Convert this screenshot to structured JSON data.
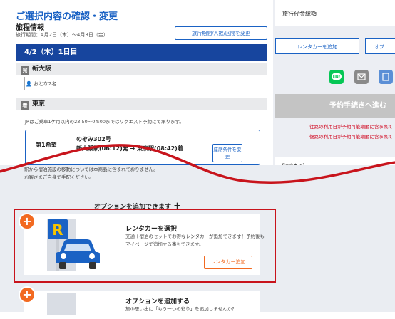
{
  "header": {
    "title": "ご選択内容の確認・変更",
    "subtitle": "旅程情報",
    "period": "旅行期間：4月2日（木）～4月3日（金）",
    "change_button": "旅行期間/人数/区間を変更"
  },
  "itinerary": {
    "day_header": "4/2（木）1日目",
    "departure_tag": "発",
    "departure": "新大阪",
    "adults": "おとな2名",
    "arrival_tag": "着",
    "arrival": "東京",
    "jr_note": "JRはご乗車1ケ月以内の23:50～04:00まではリクエスト予約にて承ります。",
    "wish_label": "第1希望",
    "train_name": "のぞみ302号",
    "route": "新大阪駅(06:12)発 → 東京駅(08:42)着",
    "condition_button": "座席条件を変更",
    "notes": [
      "駅から宿泊施設の移動については本商品に含まれておりません。",
      "お客さまご自身で手配ください。"
    ]
  },
  "sidebar": {
    "price_label": "旅行代金総額",
    "rentacar_button": "レンタカーを追加",
    "option_button": "オプ",
    "share_icons": [
      "line-icon",
      "mail-icon",
      "copy-icon"
    ],
    "proceed_button": "予約手続きへ進む",
    "warnings": [
      "往路の利用日が予約可能期間に含まれて",
      "復路の利用日が予約可能期間に含まれて"
    ],
    "notice_title": "【注意事項】"
  },
  "options": {
    "heading": "オプションを追加できます",
    "rentacar": {
      "title": "レンタカーを選択",
      "desc": "交通＋宿泊のセットでお得なレンタカーが追加できます！予約後もマイページで追加する事もできます。",
      "button": "レンタカー追加"
    },
    "more": {
      "title": "オプションを追加する",
      "desc": "旅の思い出に「もう一つの彩り」を追加しませんか？"
    }
  },
  "colors": {
    "brand_blue": "#1a62c4",
    "day_header": "#17459e",
    "accent_orange": "#f26a21",
    "highlight_red": "#c8141c"
  }
}
